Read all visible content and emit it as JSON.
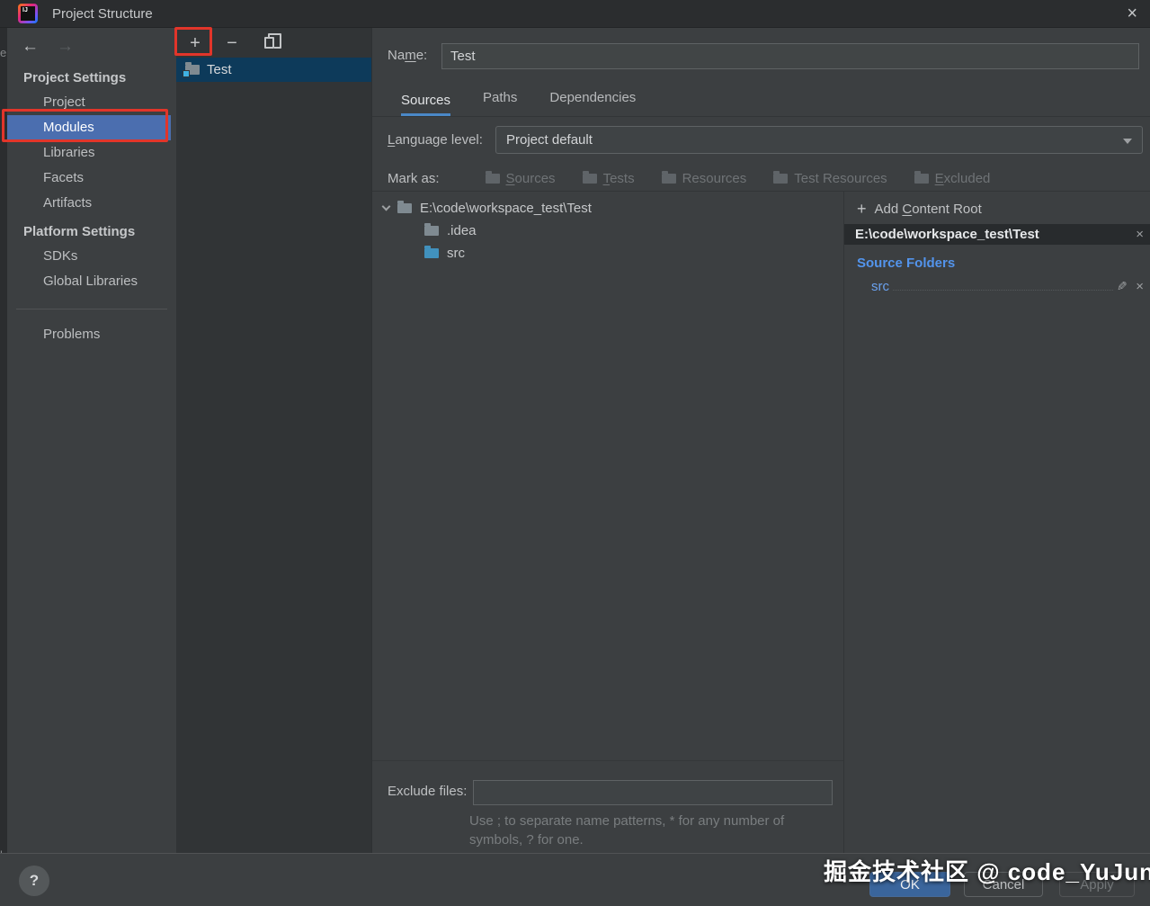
{
  "titlebar": {
    "title": "Project Structure",
    "close_icon": "×"
  },
  "background_fragments": {
    "top": "e",
    "bottom": "b"
  },
  "sidebar": {
    "back_icon": "←",
    "forward_icon": "→",
    "sections": [
      {
        "header": "Project Settings",
        "items": [
          {
            "label": "Project",
            "selected": false
          },
          {
            "label": "Modules",
            "selected": true
          },
          {
            "label": "Libraries",
            "selected": false
          },
          {
            "label": "Facets",
            "selected": false
          },
          {
            "label": "Artifacts",
            "selected": false
          }
        ]
      },
      {
        "header": "Platform Settings",
        "items": [
          {
            "label": "SDKs",
            "selected": false
          },
          {
            "label": "Global Libraries",
            "selected": false
          }
        ]
      }
    ],
    "problems_label": "Problems"
  },
  "module_list": {
    "toolbar": {
      "add_icon": "+",
      "remove_icon": "−",
      "copy_icon": "copy"
    },
    "items": [
      {
        "name": "Test",
        "selected": true
      }
    ]
  },
  "main": {
    "name_field": {
      "label_pre": "Na",
      "label_mn": "m",
      "label_post": "e:",
      "value": "Test"
    },
    "tabs": [
      {
        "label": "Sources",
        "active": true
      },
      {
        "label": "Paths",
        "active": false
      },
      {
        "label": "Dependencies",
        "active": false
      }
    ],
    "language_level": {
      "label_mn": "L",
      "label_post": "anguage level:",
      "value": "Project default"
    },
    "mark_as": {
      "label": "Mark as:",
      "buttons": [
        {
          "pre": "",
          "mn": "S",
          "post": "ources"
        },
        {
          "pre": "",
          "mn": "T",
          "post": "ests"
        },
        {
          "pre": "",
          "mn": "",
          "post": "Resources"
        },
        {
          "pre": "",
          "mn": "",
          "post": "Test Resources"
        },
        {
          "pre": "",
          "mn": "E",
          "post": "xcluded"
        }
      ]
    },
    "tree": {
      "root": "E:\\code\\workspace_test\\Test",
      "children": [
        {
          "name": ".idea",
          "type": "regular"
        },
        {
          "name": "src",
          "type": "source"
        }
      ]
    },
    "exclude": {
      "label": "Exclude files:",
      "value": "",
      "hint_line1": "Use ; to separate name patterns, * for any number of",
      "hint_line2": "symbols, ? for one."
    }
  },
  "right_panel": {
    "add_content_root": {
      "plus": "+",
      "pre": "Add ",
      "mn": "C",
      "post": "ontent Root"
    },
    "content_root": {
      "path": "E:\\code\\workspace_test\\Test",
      "close_icon": "×"
    },
    "source_folders_label": "Source Folders",
    "folders": [
      {
        "name": "src",
        "edit_icon": "✎",
        "remove_icon": "×"
      }
    ]
  },
  "footer": {
    "help_icon": "?",
    "ok_label": "OK",
    "cancel_label": "Cancel",
    "apply_label": "Apply"
  },
  "watermark": "掘金技术社区 @ code_YuJun",
  "colors": {
    "selection_blue": "#4b6eaf",
    "list_selection_navy": "#0d3a5a",
    "tab_underline": "#4a88c7",
    "link_blue": "#5394ec",
    "source_folder_blue": "#4191bd",
    "ok_button": "#3a659c",
    "annotation_red": "#e2352a",
    "dialog_bg": "#3c3f41",
    "panel_dark_bg": "#313436",
    "titlebar_bg": "#2b2d2f"
  }
}
